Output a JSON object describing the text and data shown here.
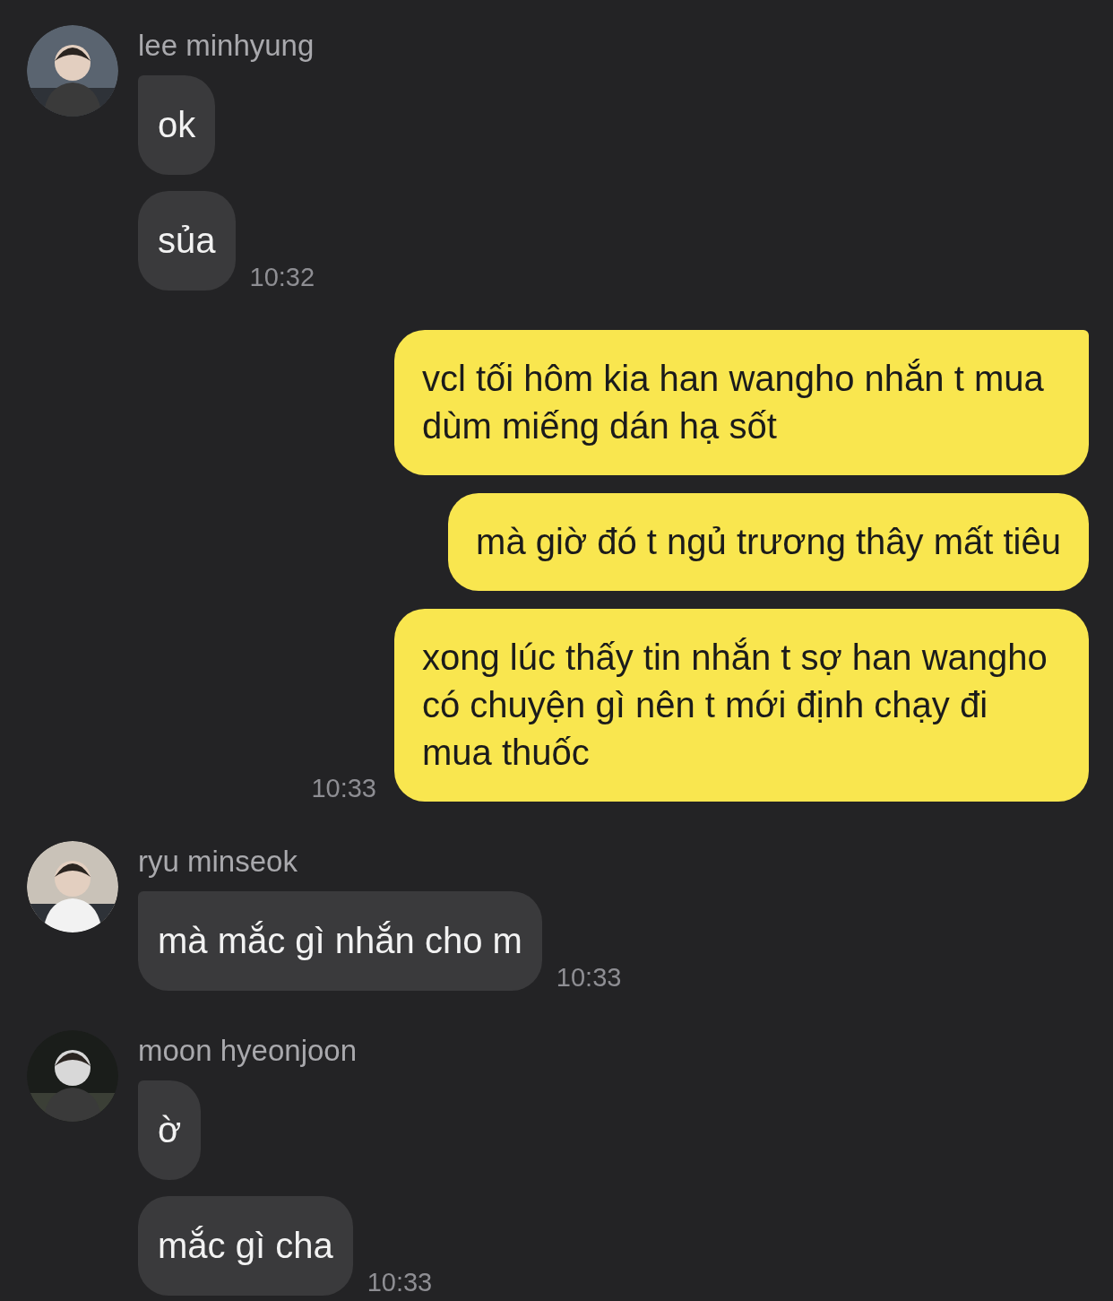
{
  "groups": [
    {
      "kind": "incoming",
      "sender": "lee minhyung",
      "messages": [
        {
          "text": "ok"
        },
        {
          "text": "sủa",
          "time": "10:32"
        }
      ]
    },
    {
      "kind": "outgoing",
      "messages": [
        {
          "text": "vcl tối hôm kia han wangho nhắn t mua dùm miếng dán hạ sốt"
        },
        {
          "text": "mà giờ đó t ngủ trương thây mất tiêu"
        },
        {
          "text": "xong lúc thấy tin nhắn t sợ han wangho có chuyện gì nên t mới định chạy đi mua thuốc",
          "time": "10:33"
        }
      ]
    },
    {
      "kind": "incoming",
      "sender": "ryu minseok",
      "messages": [
        {
          "text": "mà mắc gì nhắn cho m",
          "time": "10:33"
        }
      ]
    },
    {
      "kind": "incoming",
      "sender": "moon hyeonjoon",
      "messages": [
        {
          "text": "ờ"
        },
        {
          "text": "mắc gì cha",
          "time": "10:33"
        }
      ]
    }
  ]
}
